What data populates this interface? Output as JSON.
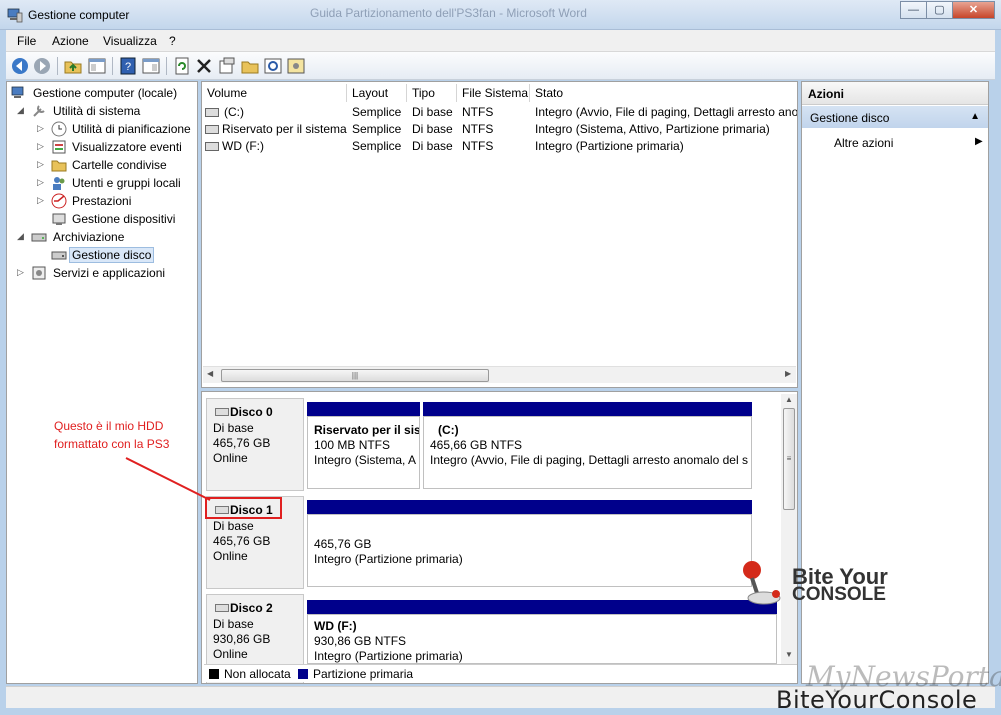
{
  "window": {
    "title": "Gestione computer",
    "ghost_title": "Guida Partizionamento dell'PS3fan - Microsoft Word",
    "buttons": {
      "minimize": "—",
      "restore": "▢",
      "close": "✕"
    }
  },
  "menu": [
    "File",
    "Azione",
    "Visualizza",
    "?"
  ],
  "toolbar_icons": [
    "back-icon",
    "forward-icon",
    "up-folder-icon",
    "console-tree-icon",
    "help-icon",
    "show-hide-icon",
    "refresh-icon",
    "delete-icon",
    "properties-icon",
    "open-icon",
    "search-icon",
    "settings-icon"
  ],
  "tree": {
    "root": "Gestione computer (locale)",
    "system_tools": "Utilità di sistema",
    "scheduler": "Utilità di pianificazione",
    "event_viewer": "Visualizzatore eventi",
    "shared_folders": "Cartelle condivise",
    "users_groups": "Utenti e gruppi locali",
    "performance": "Prestazioni",
    "device_manager": "Gestione dispositivi",
    "storage": "Archiviazione",
    "disk_management": "Gestione disco",
    "services_apps": "Servizi e applicazioni"
  },
  "volumes": {
    "headers": [
      "Volume",
      "Layout",
      "Tipo",
      "File Sistema",
      "Stato"
    ],
    "rows": [
      {
        "volume": "(C:)",
        "layout": "Semplice",
        "type": "Di base",
        "fs": "NTFS",
        "status": "Integro (Avvio, File di paging, Dettagli arresto ano"
      },
      {
        "volume": "Riservato per il sistema",
        "layout": "Semplice",
        "type": "Di base",
        "fs": "NTFS",
        "status": "Integro (Sistema, Attivo, Partizione primaria)"
      },
      {
        "volume": "WD (F:)",
        "layout": "Semplice",
        "type": "Di base",
        "fs": "NTFS",
        "status": "Integro (Partizione primaria)"
      }
    ]
  },
  "disks": {
    "disk0": {
      "name": "Disco 0",
      "type": "Di base",
      "size": "465,76 GB",
      "status": "Online",
      "p1": {
        "name": "Riservato per il sis",
        "size": "100 MB NTFS",
        "status": "Integro (Sistema, A"
      },
      "p2": {
        "name": "(C:)",
        "size": "465,66 GB NTFS",
        "status": "Integro (Avvio, File di paging, Dettagli arresto anomalo del s"
      }
    },
    "disk1": {
      "name": "Disco 1",
      "type": "Di base",
      "size": "465,76 GB",
      "status": "Online",
      "p1": {
        "size": "465,76 GB",
        "status": "Integro (Partizione primaria)"
      }
    },
    "disk2": {
      "name": "Disco 2",
      "type": "Di base",
      "size": "930,86 GB",
      "status": "Online",
      "p1": {
        "name": "WD  (F:)",
        "size": "930,86 GB NTFS",
        "status": "Integro (Partizione primaria)"
      }
    }
  },
  "legend": {
    "unallocated": "Non allocata",
    "primary": "Partizione primaria"
  },
  "actions": {
    "header": "Azioni",
    "section": "Gestione disco",
    "more": "Altre azioni"
  },
  "annotation": {
    "line1": "Questo è il mio HDD",
    "line2": "formattato con la PS3"
  },
  "watermark": {
    "logo_line1": "Bite Your",
    "logo_line2": "CONSOLE",
    "portal": "MyNewsPortal.IT",
    "bottom": "BiteYourConsole"
  },
  "colors": {
    "primary_partition": "#00008b",
    "unallocated": "#000000",
    "annotation": "#e02020"
  }
}
